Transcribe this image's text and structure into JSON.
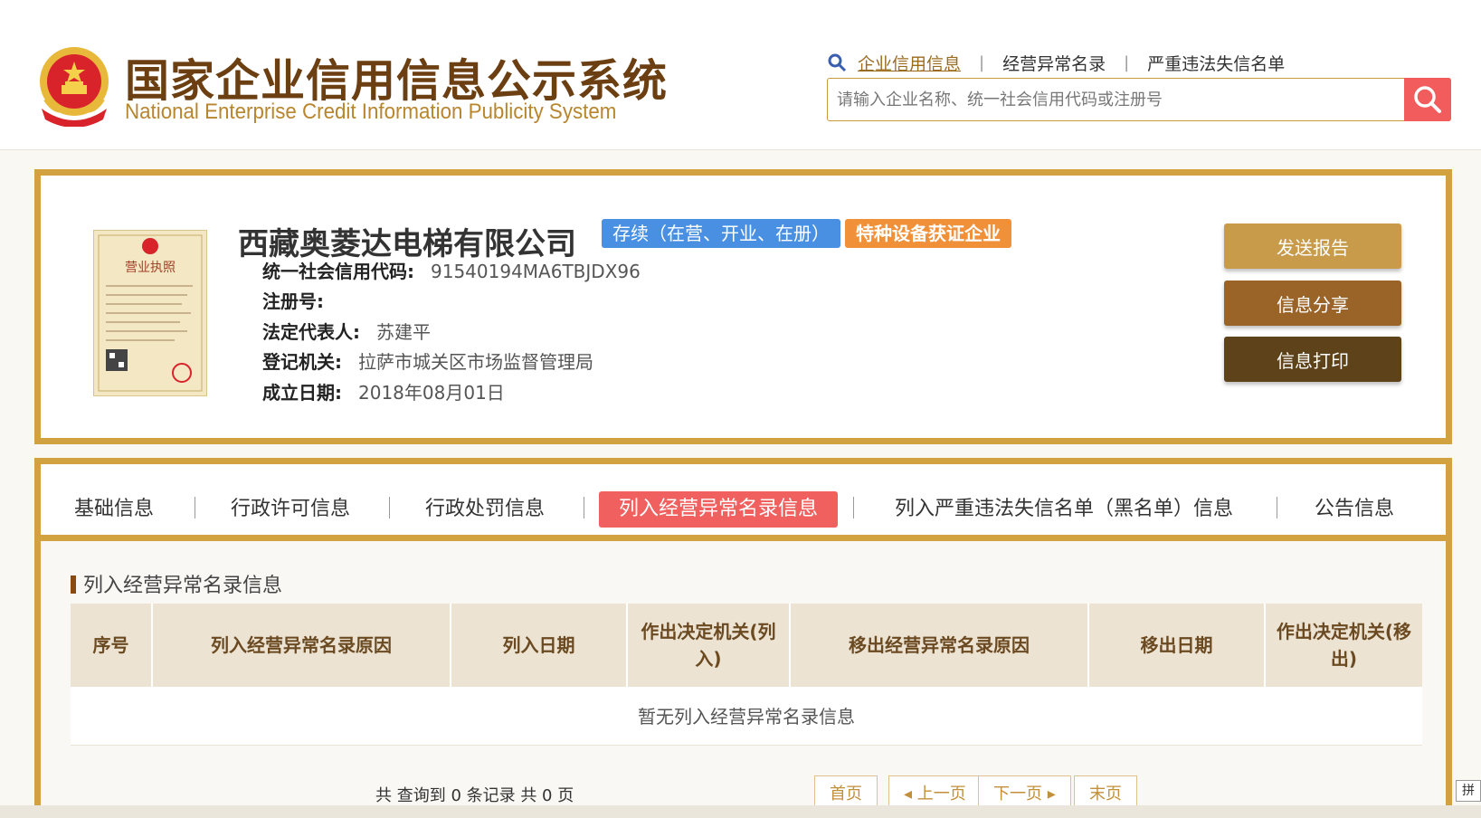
{
  "header": {
    "title_cn": "国家企业信用信息公示系统",
    "title_en": "National Enterprise Credit Information Publicity System",
    "nav": [
      {
        "label": "企业信用信息",
        "active": true
      },
      {
        "label": "经营异常名录",
        "active": false
      },
      {
        "label": "严重违法失信名单",
        "active": false
      }
    ],
    "search_placeholder": "请输入企业名称、统一社会信用代码或注册号"
  },
  "company": {
    "name": "西藏奥菱达电梯有限公司",
    "status_badge": "存续（在营、开业、在册）",
    "cert_badge": "特种设备获证企业",
    "fields": [
      {
        "key": "统一社会信用代码:",
        "value": "91540194MA6TBJDX96"
      },
      {
        "key": "注册号:",
        "value": ""
      },
      {
        "key": "法定代表人:",
        "value": "苏建平"
      },
      {
        "key": "登记机关:",
        "value": "拉萨市城关区市场监督管理局"
      },
      {
        "key": "成立日期:",
        "value": "2018年08月01日"
      }
    ],
    "license_title": "营业执照",
    "actions": {
      "report": "发送报告",
      "share": "信息分享",
      "print": "信息打印"
    }
  },
  "tabs": [
    {
      "label": "基础信息"
    },
    {
      "label": "行政许可信息"
    },
    {
      "label": "行政处罚信息"
    },
    {
      "label": "列入经营异常名录信息"
    },
    {
      "label": "列入严重违法失信名单（黑名单）信息"
    },
    {
      "label": "公告信息"
    }
  ],
  "section": {
    "title": "列入经营异常名录信息",
    "columns": [
      "序号",
      "列入经营异常名录原因",
      "列入日期",
      "作出决定机关(列入)",
      "移出经营异常名录原因",
      "移出日期",
      "作出决定机关(移出)"
    ],
    "empty_text": "暂无列入经营异常名录信息"
  },
  "pager": {
    "summary": "共 查询到 0 条记录 共 0 页",
    "first": "首页",
    "prev": "◂ 上一页",
    "next": "下一页 ▸",
    "last": "末页"
  },
  "ime": "拼",
  "colors": {
    "gold_border": "#d1a23f",
    "active_tab": "#f0605f",
    "status_badge": "#4a90e2",
    "cert_badge": "#f0913a"
  }
}
